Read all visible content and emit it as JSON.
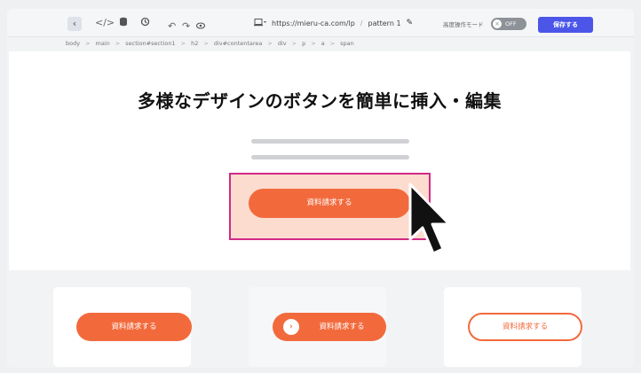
{
  "toolbar": {
    "url": "https://mieru-ca.com/lp",
    "pattern_label": "pattern 1",
    "mode_label": "高度操作モード",
    "toggle_state": "OFF",
    "save_label": "保存する"
  },
  "breadcrumb": [
    "body",
    "main",
    "section#section1",
    "h2",
    "div#contentarea",
    "div",
    "p",
    "a",
    "span"
  ],
  "breadcrumb_separator": ">",
  "main": {
    "headline": "多様なデザインのボタンを簡単に挿入・編集",
    "cta_label": "資料請求する"
  },
  "cards": [
    {
      "label": "資料請求する",
      "style": "filled"
    },
    {
      "label": "資料請求する",
      "style": "filled-with-arrow"
    },
    {
      "label": "資料請求する",
      "style": "outline"
    }
  ],
  "colors": {
    "accent": "#f26a3c",
    "highlight_fill": "#fcdccf",
    "highlight_border": "#d12a86",
    "save_button": "#4b56e8"
  },
  "icons": [
    "back-icon",
    "code-icon",
    "database-icon",
    "history-icon",
    "undo-icon",
    "redo-icon",
    "preview-eye-icon",
    "device-icon",
    "pencil-icon",
    "close-icon",
    "arrow-right-icon",
    "mouse-cursor-icon"
  ]
}
